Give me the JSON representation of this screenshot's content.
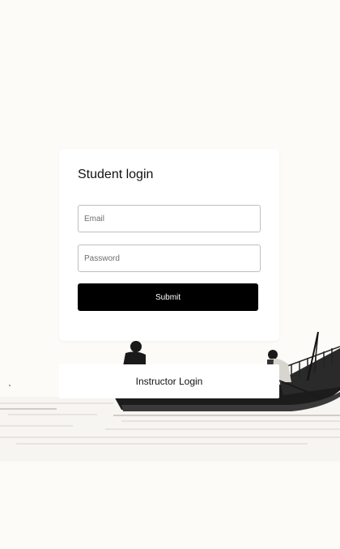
{
  "login_card": {
    "title": "Student login",
    "email_placeholder": "Email",
    "password_placeholder": "Password",
    "submit_label": "Submit"
  },
  "instructor_link": {
    "label": "Instructor Login"
  },
  "background": {
    "scene": "boat-on-water-photo",
    "page_color": "#fdfbf7"
  },
  "colors": {
    "button_bg": "#000000",
    "button_text": "#ffffff",
    "card_bg": "#ffffff"
  }
}
